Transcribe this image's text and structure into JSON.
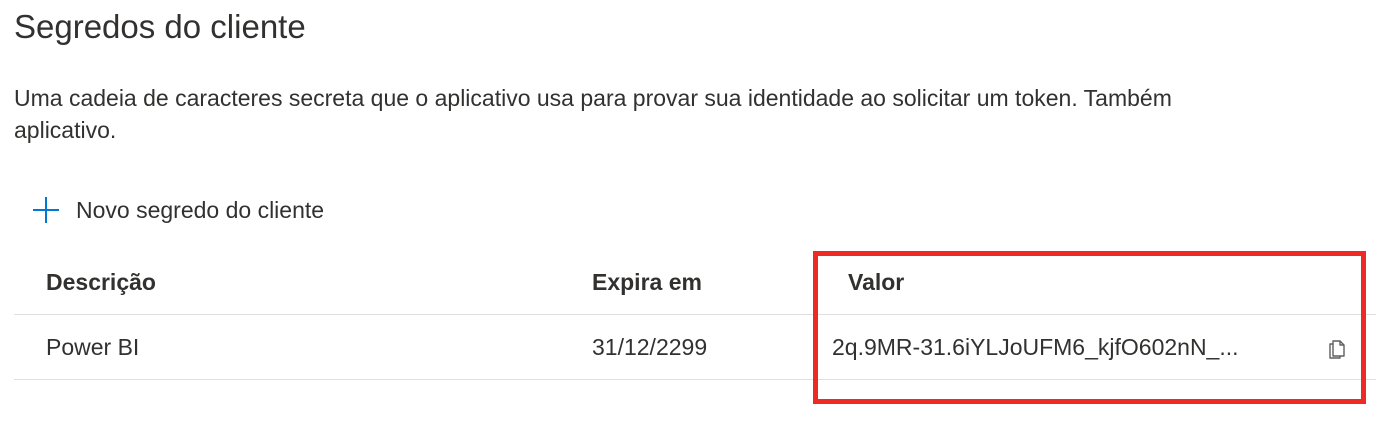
{
  "page": {
    "title": "Segredos do cliente",
    "description_line1": "Uma cadeia de caracteres secreta que o aplicativo usa para provar sua identidade ao solicitar um token. Também",
    "description_line2": "aplicativo."
  },
  "toolbar": {
    "new_secret_label": "Novo segredo do cliente",
    "new_secret_icon": "plus-icon"
  },
  "table": {
    "columns": [
      "Descrição",
      "Expira em",
      "Valor"
    ],
    "rows": [
      {
        "description": "Power BI",
        "expires": "31/12/2299",
        "value": "2q.9MR-31.6iYLJoUFM6_kjfO602nN_...",
        "copy_icon": "copy-icon"
      }
    ]
  },
  "colors": {
    "accent": "#0078d4",
    "highlight": "#ee2a24",
    "text": "#323130",
    "divider": "#e1dfdd"
  }
}
